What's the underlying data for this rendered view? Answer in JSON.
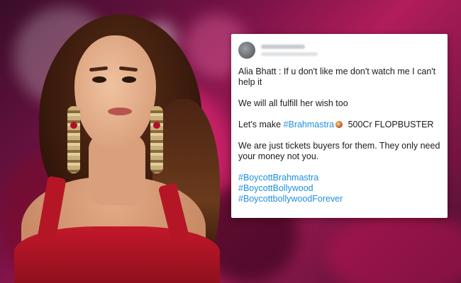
{
  "tweet": {
    "line1": "Alia Bhatt : If u don't like me don't watch me I can't help it",
    "line2": "We will all fulfill her wish too",
    "line3_prefix": "Let's make ",
    "line3_tag": "#Brahmastra",
    "line3_suffix": " 500Cr FLOPBUSTER",
    "line4": "We are just tickets buyers for them. They only need your money not you.",
    "hashtags": [
      "#BoycottBrahmastra",
      "#BoycottBollywood",
      "#BoycottbollywoodForever"
    ],
    "hashtag_color": "#1d8fe0"
  }
}
